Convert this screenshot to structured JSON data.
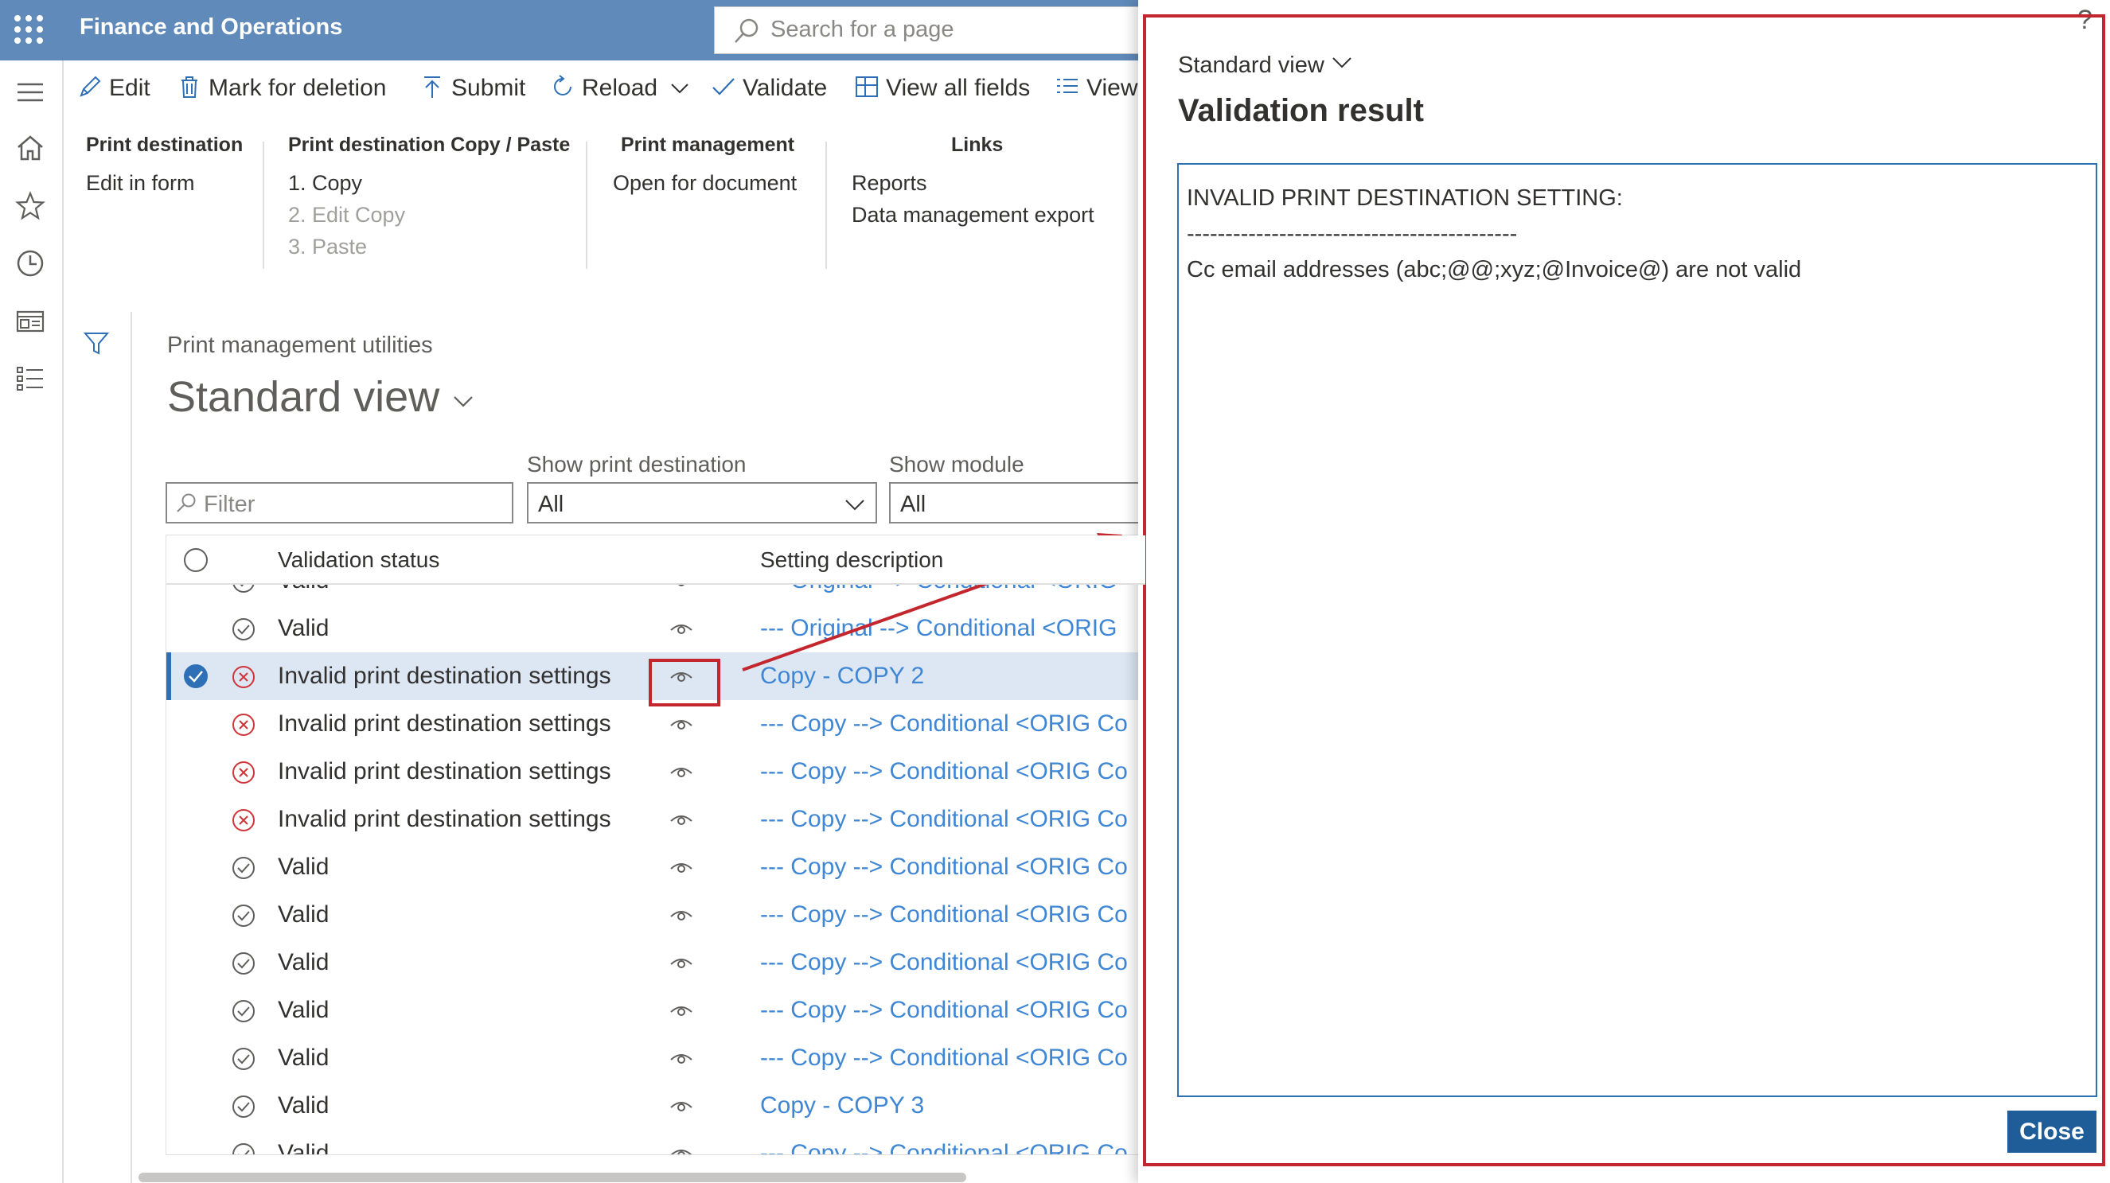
{
  "app": {
    "title": "Finance and Operations",
    "search_placeholder": "Search for a page"
  },
  "toolbar": {
    "edit": "Edit",
    "mark_for_deletion": "Mark for deletion",
    "submit": "Submit",
    "reload": "Reload",
    "validate": "Validate",
    "view_all_fields": "View all fields",
    "view": "View"
  },
  "action_groups": [
    {
      "header": "Print destination",
      "items": [
        {
          "label": "Edit in form",
          "enabled": true
        }
      ]
    },
    {
      "header": "Print destination Copy / Paste",
      "items": [
        {
          "label": "1. Copy",
          "enabled": true
        },
        {
          "label": "2. Edit Copy",
          "enabled": false
        },
        {
          "label": "3. Paste",
          "enabled": false
        }
      ]
    },
    {
      "header": "Print management",
      "items": [
        {
          "label": "Open for document",
          "enabled": true
        }
      ]
    },
    {
      "header": "Links",
      "items": [
        {
          "label": "Reports",
          "enabled": true
        },
        {
          "label": "Data management export",
          "enabled": true
        }
      ]
    }
  ],
  "page": {
    "breadcrumb": "Print management utilities",
    "view_title": "Standard view"
  },
  "filters": {
    "filter_placeholder": "Filter",
    "print_dest_label": "Show print destination",
    "print_dest_value": "All",
    "module_label": "Show module",
    "module_value": "All"
  },
  "grid": {
    "columns": [
      "Validation status",
      "Setting description"
    ],
    "rows": [
      {
        "status": "Valid",
        "valid": true,
        "description": "--- Original --> Conditional <ORIG",
        "selected": false
      },
      {
        "status": "Valid",
        "valid": true,
        "description": "--- Original --> Conditional <ORIG",
        "selected": false
      },
      {
        "status": "Invalid print destination settings",
        "valid": false,
        "description": "Copy - COPY 2",
        "selected": true
      },
      {
        "status": "Invalid print destination settings",
        "valid": false,
        "description": "--- Copy --> Conditional <ORIG Co",
        "selected": false
      },
      {
        "status": "Invalid print destination settings",
        "valid": false,
        "description": "--- Copy --> Conditional <ORIG Co",
        "selected": false
      },
      {
        "status": "Invalid print destination settings",
        "valid": false,
        "description": "--- Copy --> Conditional <ORIG Co",
        "selected": false
      },
      {
        "status": "Valid",
        "valid": true,
        "description": "--- Copy --> Conditional <ORIG Co",
        "selected": false
      },
      {
        "status": "Valid",
        "valid": true,
        "description": "--- Copy --> Conditional <ORIG Co",
        "selected": false
      },
      {
        "status": "Valid",
        "valid": true,
        "description": "--- Copy --> Conditional <ORIG Co",
        "selected": false
      },
      {
        "status": "Valid",
        "valid": true,
        "description": "--- Copy --> Conditional <ORIG Co",
        "selected": false
      },
      {
        "status": "Valid",
        "valid": true,
        "description": "--- Copy --> Conditional <ORIG Co",
        "selected": false
      },
      {
        "status": "Valid",
        "valid": true,
        "description": "Copy - COPY 3",
        "selected": false
      },
      {
        "status": "Valid",
        "valid": true,
        "description": "--- Copy --> Conditional <ORIG Co",
        "selected": false
      }
    ]
  },
  "panel": {
    "view_label": "Standard view",
    "title": "Validation result",
    "message_lines": [
      "INVALID PRINT DESTINATION SETTING:",
      "-------------------------------------------",
      "Cc email addresses (abc;@@;xyz;@Invoice@) are not valid"
    ],
    "close_label": "Close",
    "help_glyph": "?"
  },
  "colors": {
    "topbar": "#5f8ab9",
    "accent": "#1f5d99",
    "link": "#3f86d4",
    "invalid": "#d13438",
    "valid": "#605e5c",
    "callout": "#c4262e",
    "selected_row": "#dde7f3"
  }
}
